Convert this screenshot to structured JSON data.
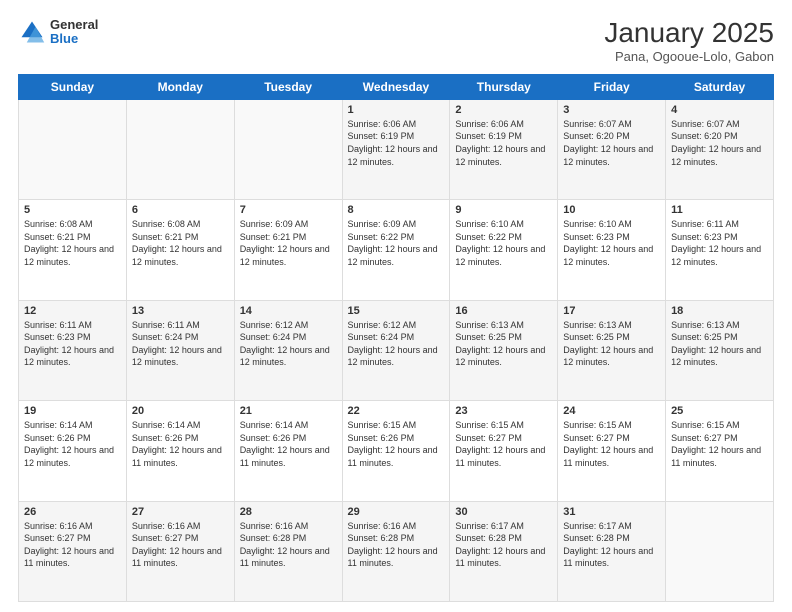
{
  "header": {
    "title": "January 2025",
    "subtitle": "Pana, Ogooue-Lolo, Gabon",
    "logo_line1": "General",
    "logo_line2": "Blue"
  },
  "days_of_week": [
    "Sunday",
    "Monday",
    "Tuesday",
    "Wednesday",
    "Thursday",
    "Friday",
    "Saturday"
  ],
  "weeks": [
    [
      {
        "day": "",
        "info": ""
      },
      {
        "day": "",
        "info": ""
      },
      {
        "day": "",
        "info": ""
      },
      {
        "day": "1",
        "info": "Sunrise: 6:06 AM\nSunset: 6:19 PM\nDaylight: 12 hours and 12 minutes."
      },
      {
        "day": "2",
        "info": "Sunrise: 6:06 AM\nSunset: 6:19 PM\nDaylight: 12 hours and 12 minutes."
      },
      {
        "day": "3",
        "info": "Sunrise: 6:07 AM\nSunset: 6:20 PM\nDaylight: 12 hours and 12 minutes."
      },
      {
        "day": "4",
        "info": "Sunrise: 6:07 AM\nSunset: 6:20 PM\nDaylight: 12 hours and 12 minutes."
      }
    ],
    [
      {
        "day": "5",
        "info": "Sunrise: 6:08 AM\nSunset: 6:21 PM\nDaylight: 12 hours and 12 minutes."
      },
      {
        "day": "6",
        "info": "Sunrise: 6:08 AM\nSunset: 6:21 PM\nDaylight: 12 hours and 12 minutes."
      },
      {
        "day": "7",
        "info": "Sunrise: 6:09 AM\nSunset: 6:21 PM\nDaylight: 12 hours and 12 minutes."
      },
      {
        "day": "8",
        "info": "Sunrise: 6:09 AM\nSunset: 6:22 PM\nDaylight: 12 hours and 12 minutes."
      },
      {
        "day": "9",
        "info": "Sunrise: 6:10 AM\nSunset: 6:22 PM\nDaylight: 12 hours and 12 minutes."
      },
      {
        "day": "10",
        "info": "Sunrise: 6:10 AM\nSunset: 6:23 PM\nDaylight: 12 hours and 12 minutes."
      },
      {
        "day": "11",
        "info": "Sunrise: 6:11 AM\nSunset: 6:23 PM\nDaylight: 12 hours and 12 minutes."
      }
    ],
    [
      {
        "day": "12",
        "info": "Sunrise: 6:11 AM\nSunset: 6:23 PM\nDaylight: 12 hours and 12 minutes."
      },
      {
        "day": "13",
        "info": "Sunrise: 6:11 AM\nSunset: 6:24 PM\nDaylight: 12 hours and 12 minutes."
      },
      {
        "day": "14",
        "info": "Sunrise: 6:12 AM\nSunset: 6:24 PM\nDaylight: 12 hours and 12 minutes."
      },
      {
        "day": "15",
        "info": "Sunrise: 6:12 AM\nSunset: 6:24 PM\nDaylight: 12 hours and 12 minutes."
      },
      {
        "day": "16",
        "info": "Sunrise: 6:13 AM\nSunset: 6:25 PM\nDaylight: 12 hours and 12 minutes."
      },
      {
        "day": "17",
        "info": "Sunrise: 6:13 AM\nSunset: 6:25 PM\nDaylight: 12 hours and 12 minutes."
      },
      {
        "day": "18",
        "info": "Sunrise: 6:13 AM\nSunset: 6:25 PM\nDaylight: 12 hours and 12 minutes."
      }
    ],
    [
      {
        "day": "19",
        "info": "Sunrise: 6:14 AM\nSunset: 6:26 PM\nDaylight: 12 hours and 12 minutes."
      },
      {
        "day": "20",
        "info": "Sunrise: 6:14 AM\nSunset: 6:26 PM\nDaylight: 12 hours and 11 minutes."
      },
      {
        "day": "21",
        "info": "Sunrise: 6:14 AM\nSunset: 6:26 PM\nDaylight: 12 hours and 11 minutes."
      },
      {
        "day": "22",
        "info": "Sunrise: 6:15 AM\nSunset: 6:26 PM\nDaylight: 12 hours and 11 minutes."
      },
      {
        "day": "23",
        "info": "Sunrise: 6:15 AM\nSunset: 6:27 PM\nDaylight: 12 hours and 11 minutes."
      },
      {
        "day": "24",
        "info": "Sunrise: 6:15 AM\nSunset: 6:27 PM\nDaylight: 12 hours and 11 minutes."
      },
      {
        "day": "25",
        "info": "Sunrise: 6:15 AM\nSunset: 6:27 PM\nDaylight: 12 hours and 11 minutes."
      }
    ],
    [
      {
        "day": "26",
        "info": "Sunrise: 6:16 AM\nSunset: 6:27 PM\nDaylight: 12 hours and 11 minutes."
      },
      {
        "day": "27",
        "info": "Sunrise: 6:16 AM\nSunset: 6:27 PM\nDaylight: 12 hours and 11 minutes."
      },
      {
        "day": "28",
        "info": "Sunrise: 6:16 AM\nSunset: 6:28 PM\nDaylight: 12 hours and 11 minutes."
      },
      {
        "day": "29",
        "info": "Sunrise: 6:16 AM\nSunset: 6:28 PM\nDaylight: 12 hours and 11 minutes."
      },
      {
        "day": "30",
        "info": "Sunrise: 6:17 AM\nSunset: 6:28 PM\nDaylight: 12 hours and 11 minutes."
      },
      {
        "day": "31",
        "info": "Sunrise: 6:17 AM\nSunset: 6:28 PM\nDaylight: 12 hours and 11 minutes."
      },
      {
        "day": "",
        "info": ""
      }
    ]
  ]
}
